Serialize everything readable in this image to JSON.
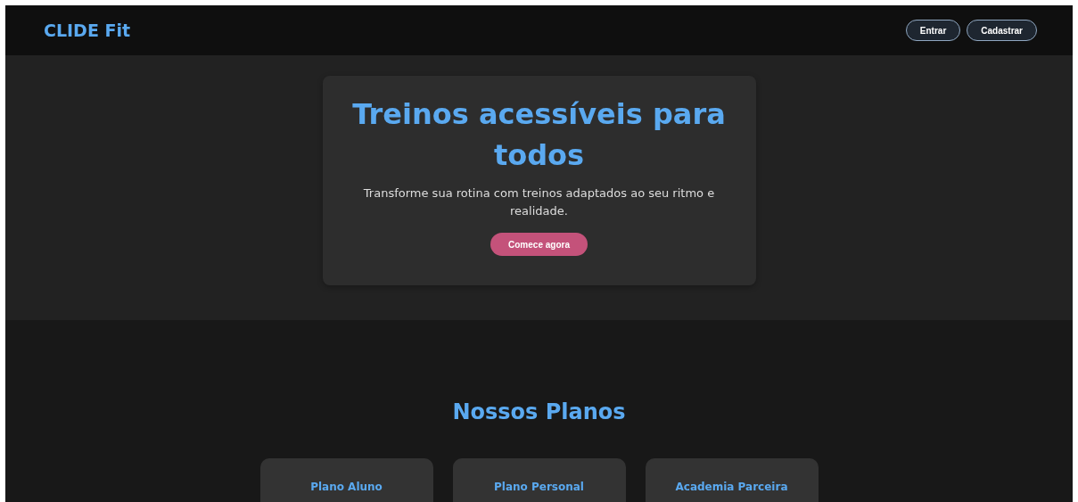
{
  "header": {
    "logo": "CLIDE Fit",
    "buttons": [
      "Entrar",
      "Cadastrar"
    ]
  },
  "hero": {
    "title": "Treinos acessíveis para todos",
    "subtitle": "Transforme sua rotina com treinos adaptados ao seu ritmo e realidade.",
    "cta": "Comece agora"
  },
  "plans": {
    "title": "Nossos Planos",
    "cards": [
      {
        "title": "Plano Aluno"
      },
      {
        "title": "Plano Personal"
      },
      {
        "title": "Academia Parceira"
      }
    ]
  }
}
